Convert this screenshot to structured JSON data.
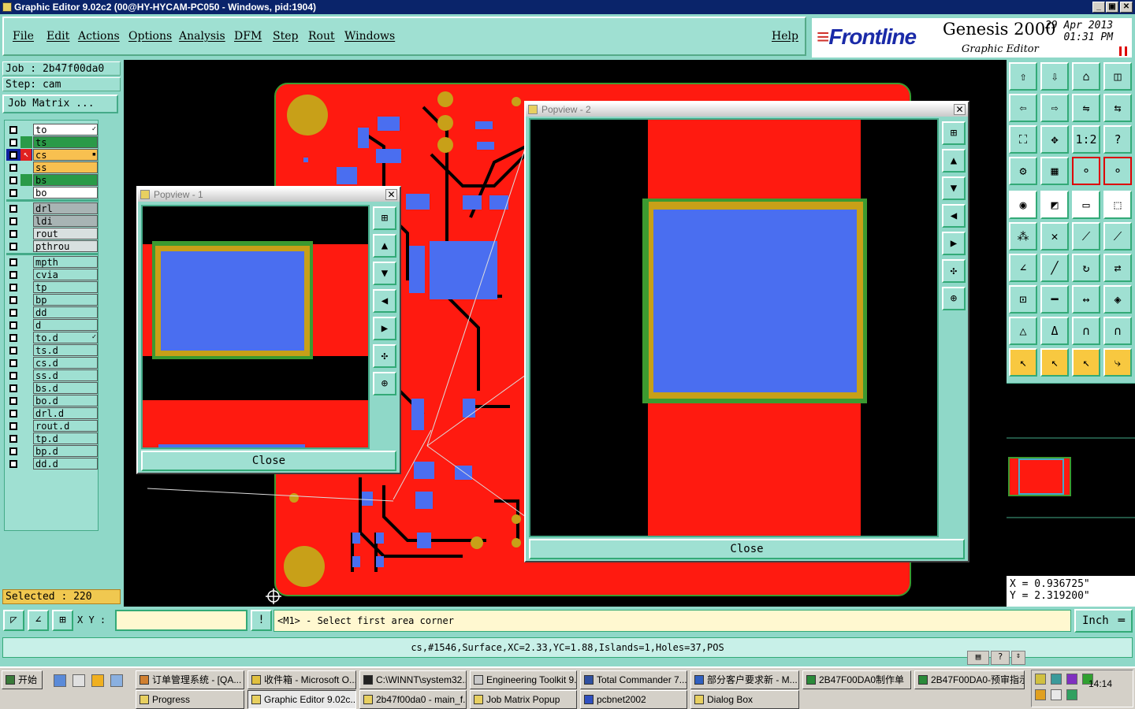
{
  "window": {
    "title": "Graphic Editor 9.02c2 (00@HY-HYCAM-PC050 - Windows, pid:1904)",
    "controls": [
      "_",
      "▣",
      "✕"
    ]
  },
  "menu": {
    "items": [
      "File",
      "Edit",
      "Actions",
      "Options",
      "Analysis",
      "DFM",
      "Step",
      "Rout",
      "Windows"
    ],
    "help": "Help"
  },
  "brand": {
    "logo": "Frontline",
    "product": "Genesis 2000",
    "subtitle": "Graphic Editor",
    "date": "29 Apr 2013",
    "time": "01:31 PM"
  },
  "job": {
    "job_label": "Job : 2b47f00da0",
    "step_label": "Step: cam",
    "job_matrix": "Job Matrix ..."
  },
  "layers": {
    "group1": [
      {
        "name": "to",
        "color": "#ffffff",
        "mark": "✓"
      },
      {
        "name": "ts",
        "color": "#2a9a48",
        "mark": ""
      },
      {
        "name": "cs",
        "color": "#f8c050",
        "mark": "▪"
      },
      {
        "name": "ss",
        "color": "#f8c050",
        "mark": ""
      },
      {
        "name": "bs",
        "color": "#2a9a48",
        "mark": ""
      },
      {
        "name": "bo",
        "color": "#ffffff",
        "mark": ""
      }
    ],
    "group2": [
      {
        "name": "drl",
        "color": "#a8b4b4"
      },
      {
        "name": "ldi",
        "color": "#a8b4b4"
      },
      {
        "name": "rout",
        "color": "#d8e0e0"
      },
      {
        "name": "pthrou",
        "color": "#d8e0e0"
      }
    ],
    "group3": [
      {
        "name": "mpth",
        "mark": ""
      },
      {
        "name": "cvia",
        "mark": ""
      },
      {
        "name": "tp",
        "mark": ""
      },
      {
        "name": "bp",
        "mark": ""
      },
      {
        "name": "dd",
        "mark": ""
      },
      {
        "name": "d",
        "mark": ""
      },
      {
        "name": "to.d",
        "mark": "✓"
      },
      {
        "name": "ts.d",
        "mark": ""
      },
      {
        "name": "cs.d",
        "mark": ""
      },
      {
        "name": "ss.d",
        "mark": ""
      },
      {
        "name": "bs.d",
        "mark": ""
      },
      {
        "name": "bo.d",
        "mark": ""
      },
      {
        "name": "drl.d",
        "mark": ""
      },
      {
        "name": "rout.d",
        "mark": ""
      },
      {
        "name": "tp.d",
        "mark": ""
      },
      {
        "name": "bp.d",
        "mark": ""
      },
      {
        "name": "dd.d",
        "mark": ""
      }
    ]
  },
  "selected": "Selected : 220",
  "popview1": {
    "title": "Popview - 1",
    "close": "Close"
  },
  "popview2": {
    "title": "Popview - 2",
    "close": "Close"
  },
  "coords": {
    "x": "X = 0.936725\"",
    "y": "Y = 2.319200\""
  },
  "command": {
    "xy_label": "X Y :",
    "prompt": "<M1> - Select first area corner",
    "unit": "Inch"
  },
  "status": "cs,#1546,Surface,XC=2.33,YC=1.88,Islands=1,Holes=37,POS",
  "taskbar": {
    "start": "开始",
    "row1": [
      "订单管理系统 - [QA...",
      "收件箱 - Microsoft O...",
      "C:\\WINNT\\system32...",
      "Engineering Toolkit 9....",
      "Total Commander 7....",
      "部分客户要求新 - M...",
      "2B47F00DA0制作单",
      "2B47F00DA0-预审指示"
    ],
    "row2": [
      "Progress",
      "Graphic Editor 9.02c...",
      "2b47f00da0 - main_f...",
      "Job Matrix Popup",
      "pcbnet2002",
      "Dialog Box"
    ],
    "clock": "14:14"
  },
  "colors": {
    "copper": "#ff1a10",
    "pad": "#4a6ef0",
    "surface_gold": "#c8a018",
    "mask_green": "#3c9a30",
    "panel": "#8fd8c8"
  }
}
